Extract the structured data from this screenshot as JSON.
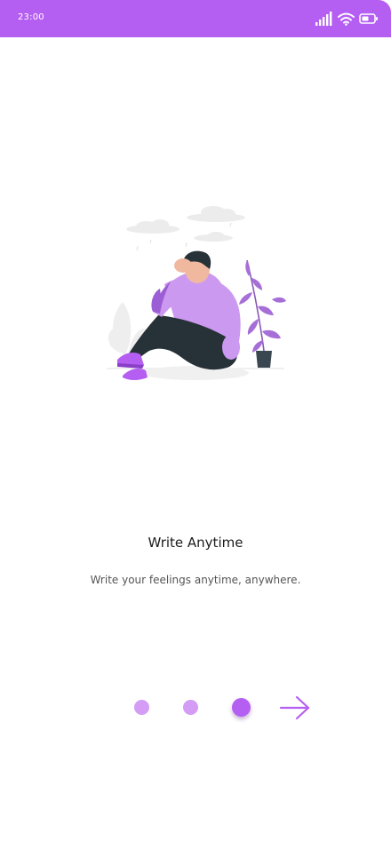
{
  "status_bar": {
    "time": "23:00",
    "icons": [
      "signal-icon",
      "wifi-icon",
      "battery-icon"
    ],
    "color": "#b55ef2"
  },
  "illustration": {
    "icon": "sad-person-sitting-illustration"
  },
  "onboarding": {
    "title": "Write Anytime",
    "subtitle": "Write your feelings anytime, anywhere."
  },
  "pager": {
    "total_pages": 3,
    "current_page": 3,
    "active_color": "#b55ef2",
    "inactive_color": "#d49cf5"
  },
  "next_button": {
    "icon": "arrow-right-icon"
  }
}
